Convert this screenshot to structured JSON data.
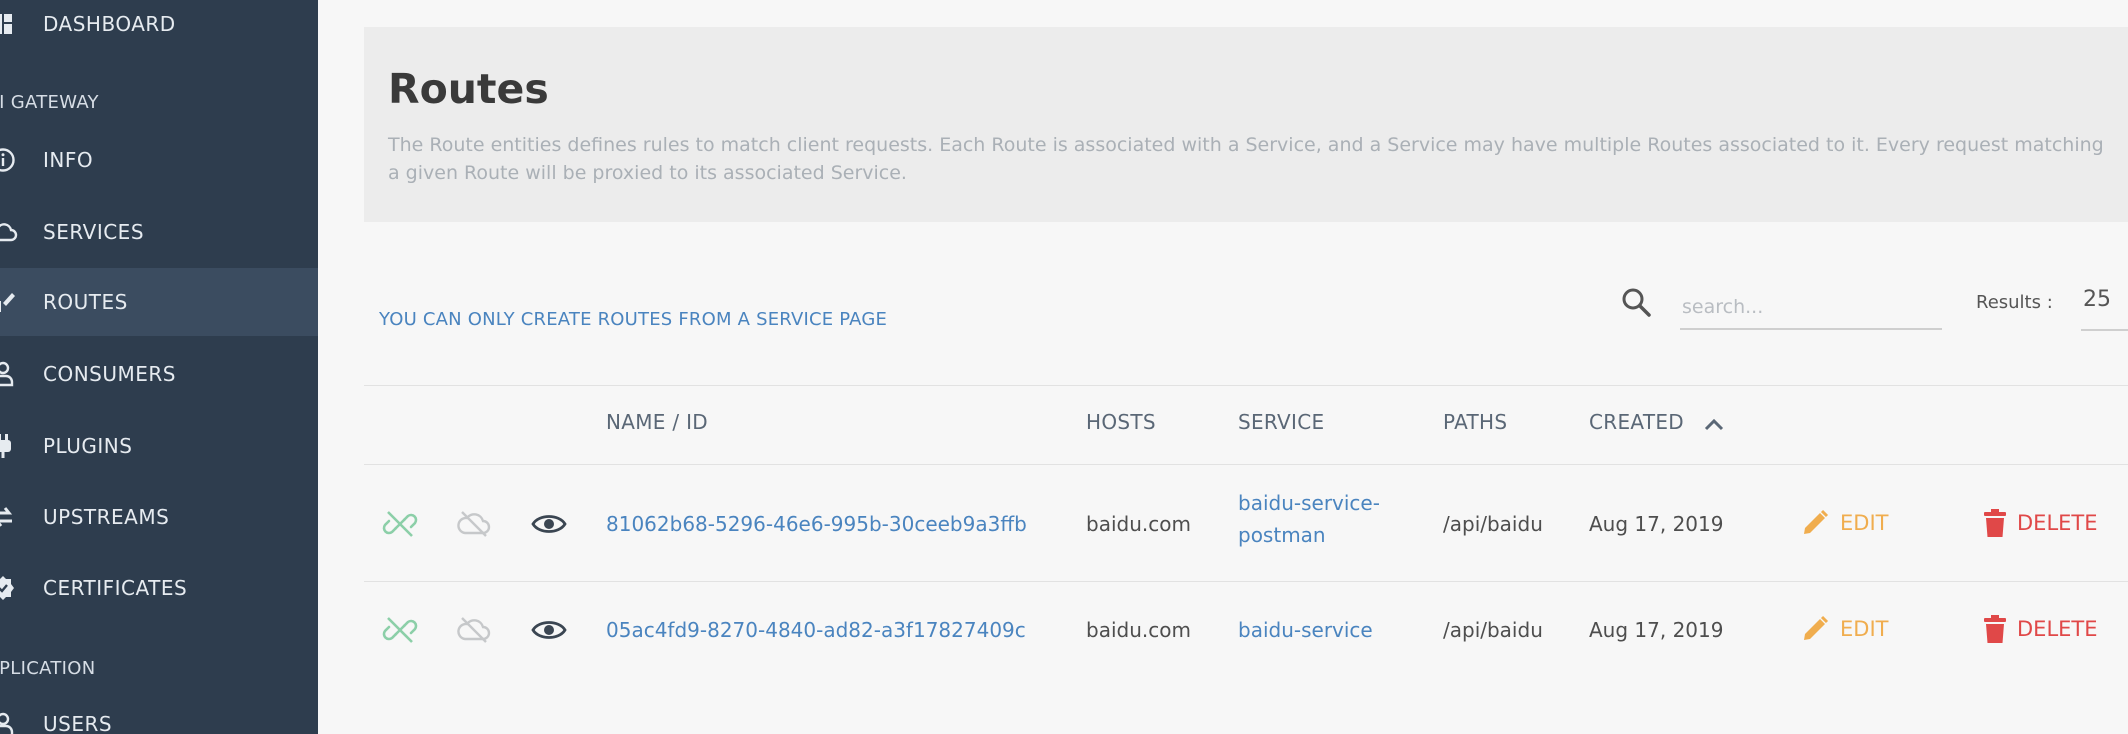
{
  "sidebar": {
    "items": [
      {
        "label": "DASHBOARD",
        "icon": "dashboard-icon"
      },
      {
        "label": "INFO",
        "icon": "info-icon"
      },
      {
        "label": "SERVICES",
        "icon": "cloud-icon"
      },
      {
        "label": "ROUTES",
        "icon": "routes-icon"
      },
      {
        "label": "CONSUMERS",
        "icon": "user-icon"
      },
      {
        "label": "PLUGINS",
        "icon": "plug-icon"
      },
      {
        "label": "UPSTREAMS",
        "icon": "swap-icon"
      },
      {
        "label": "CERTIFICATES",
        "icon": "certificate-icon"
      },
      {
        "label": "USERS",
        "icon": "users-icon"
      }
    ],
    "sections": {
      "api_gateway": "PI GATEWAY",
      "application": "PPLICATION"
    },
    "active": "ROUTES"
  },
  "header": {
    "title": "Routes",
    "description": "The Route entities defines rules to match client requests. Each Route is associated with a Service, and a Service may have multiple Routes associated to it. Every request matching a given Route will be proxied to its associated Service."
  },
  "toolbar": {
    "notice": "YOU CAN ONLY CREATE ROUTES FROM A SERVICE PAGE",
    "search_placeholder": "search...",
    "results_label": "Results :",
    "results_value": "25"
  },
  "table": {
    "columns": [
      "NAME / ID",
      "HOSTS",
      "SERVICE",
      "PATHS",
      "CREATED"
    ],
    "rows": [
      {
        "name": "81062b68-5296-46e6-995b-30ceeb9a3ffb",
        "hosts": "baidu.com",
        "service_line1": "baidu-service-",
        "service_line2": "postman",
        "paths": "/api/baidu",
        "created": "Aug 17, 2019",
        "edit": "EDIT",
        "delete": "DELETE"
      },
      {
        "name": "05ac4fd9-8270-4840-ad82-a3f17827409c",
        "hosts": "baidu.com",
        "service_line1": "baidu-service",
        "service_line2": "",
        "paths": "/api/baidu",
        "created": "Aug 17, 2019",
        "edit": "EDIT",
        "delete": "DELETE"
      }
    ]
  },
  "colors": {
    "sidebar_bg": "#2e3d4e",
    "sidebar_active": "#3b4c60",
    "link": "#4a84bf",
    "edit": "#f0ad4e",
    "delete": "#e04848",
    "toggle_green": "#8ccfa8"
  }
}
